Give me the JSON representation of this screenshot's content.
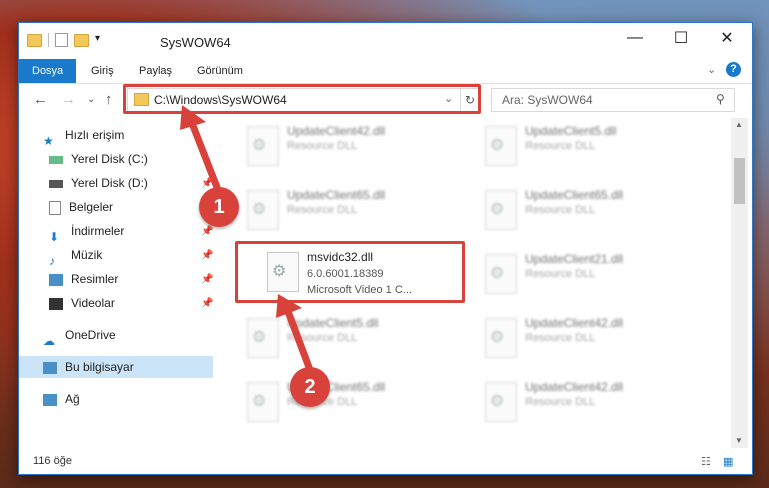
{
  "window": {
    "title": "SysWOW64",
    "minimize": "—",
    "maximize": "☐",
    "close": "✕"
  },
  "ribbon": {
    "tabs": [
      "Dosya",
      "Giriş",
      "Paylaş",
      "Görünüm"
    ]
  },
  "address": {
    "path": "C:\\Windows\\SysWOW64",
    "search_placeholder": "Ara: SysWOW64"
  },
  "sidebar": {
    "items": [
      {
        "label": "Hızlı erişim"
      },
      {
        "label": "Yerel Disk (C:)"
      },
      {
        "label": "Yerel Disk (D:)"
      },
      {
        "label": "Belgeler"
      },
      {
        "label": "İndirmeler"
      },
      {
        "label": "Müzik"
      },
      {
        "label": "Resimler"
      },
      {
        "label": "Videolar"
      },
      {
        "label": "OneDrive"
      },
      {
        "label": "Bu bilgisayar"
      },
      {
        "label": "Ağ"
      }
    ]
  },
  "files": [
    {
      "name": "UpdateClient42.dll",
      "desc": "Resource DLL"
    },
    {
      "name": "UpdateClient5.dll",
      "desc": "Resource DLL"
    },
    {
      "name": "UpdateClient65.dll",
      "desc": "Resource DLL"
    },
    {
      "name": "UpdateClient65.dll",
      "desc": "Resource DLL"
    },
    {
      "name": "UpdateClient21.dll",
      "desc": "Resource DLL"
    },
    {
      "name": "UpdateClient5.dll",
      "desc": "Resource DLL"
    },
    {
      "name": "UpdateClient42.dll",
      "desc": "Resource DLL"
    },
    {
      "name": "UpdateClient65.dll",
      "desc": "Resource DLL"
    },
    {
      "name": "UpdateClient42.dll",
      "desc": "Resource DLL"
    }
  ],
  "focus_file": {
    "name": "msvidc32.dll",
    "version": "6.0.6001.18389",
    "desc": "Microsoft Video 1 C..."
  },
  "status": {
    "count": "116 öğe"
  },
  "callouts": [
    "1",
    "2"
  ],
  "colors": {
    "accent": "#1979ca",
    "highlight": "#d9423a"
  }
}
